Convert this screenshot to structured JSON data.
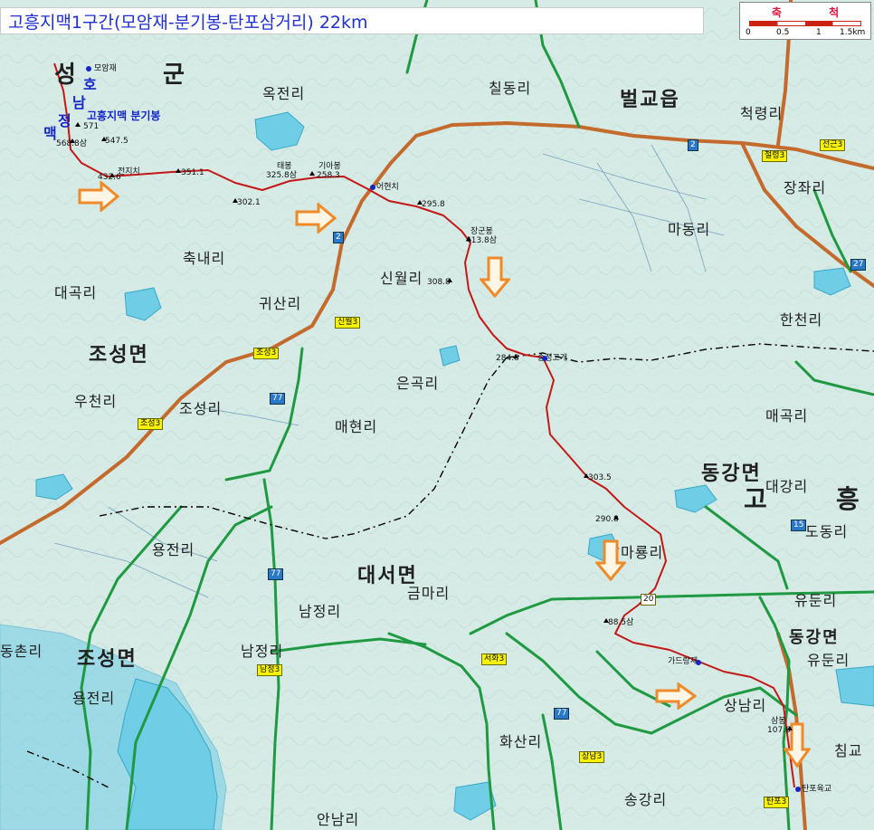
{
  "title": "고흥지맥1구간(모암재-분기봉-탄포삼거리) 22km",
  "scale": {
    "label": "축 척",
    "ticks": [
      "0",
      "0.5",
      "1",
      "1.5km"
    ]
  },
  "route_label": "고흥지맥 분기봉",
  "regions_big": {
    "beolgyo": "벌교읍",
    "joseong_n": "조성면",
    "daeseo": "대서면",
    "donggang": "동강면",
    "joseong_s": "조성면",
    "goheung_a": "고",
    "goheung_b": "흥",
    "boseong_a": "성",
    "boseong_b": "군"
  },
  "villages": {
    "okjeon": "옥전리",
    "childong": "칠동리",
    "cheokryeong": "척령리",
    "jangjwa": "장좌리",
    "madong": "마동리",
    "hancheon": "한천리",
    "chungnae": "축내리",
    "daegok": "대곡리",
    "gwisan": "귀산리",
    "sinwol": "신월리",
    "ucheon": "우천리",
    "joseong": "조성리",
    "eungok": "은곡리",
    "maehyeon": "매현리",
    "maegok": "매곡리",
    "daegang": "대강리",
    "dodong": "도동리",
    "yongjeon": "용전리",
    "maryong": "마룡리",
    "geummari": "금마리",
    "namjeong_a": "남정리",
    "namjeong_b": "남정리",
    "yudun": "유둔리",
    "yudun2": "유둔리",
    "dongchon": "동촌리",
    "yongjeon2": "용전리",
    "sangnam": "상남리",
    "hwasan": "화산리",
    "songgang": "송강리",
    "chimgyo": "침교",
    "annam": "안남리",
    "ho": "호",
    "nam": "남",
    "jeong": "정",
    "maek": "맥"
  },
  "peaks": {
    "p571": "571",
    "p5688": "568.8삼",
    "p5475": "547.5",
    "p4326": "432.6",
    "jeonjeonchi": "전지치",
    "p3611": "351.1",
    "p3021": "302.1",
    "p3258": "325.8삼",
    "taebong": "태봉",
    "giabong": "기아봉",
    "p2583": "258.3",
    "dolmochi": "어현치",
    "p2958": "295.8",
    "janggunbong": "장군봉",
    "p4138": "413.8삼",
    "p3088": "308.8",
    "p2848": "284.8",
    "songjeong": "송정고개",
    "p3035": "303.5",
    "p2908": "290.8",
    "p885": "88.5삼",
    "gadeuryeong": "가드랑재",
    "sangbong": "삼봉",
    "p1076": "107.6",
    "tanpo": "탄포육교",
    "moamjae": "모암재"
  },
  "road_signs": {
    "r2a": "2",
    "r2b": "2",
    "r77a": "77",
    "r77b": "77",
    "r77c": "77",
    "r15": "15",
    "r27": "27",
    "r20": "20",
    "s3a": "신월3",
    "s3b": "조성3",
    "s3c": "조성3",
    "s3d": "남정3",
    "s3e": "서화3",
    "s3f": "상남3",
    "s3g": "탄포3",
    "s3h": "선근3",
    "s3i": "철령3"
  },
  "route_color": "#c41818",
  "road_color": "#c46a2c",
  "road_green": "#1f9a42",
  "arrow_color": "#f08a28"
}
